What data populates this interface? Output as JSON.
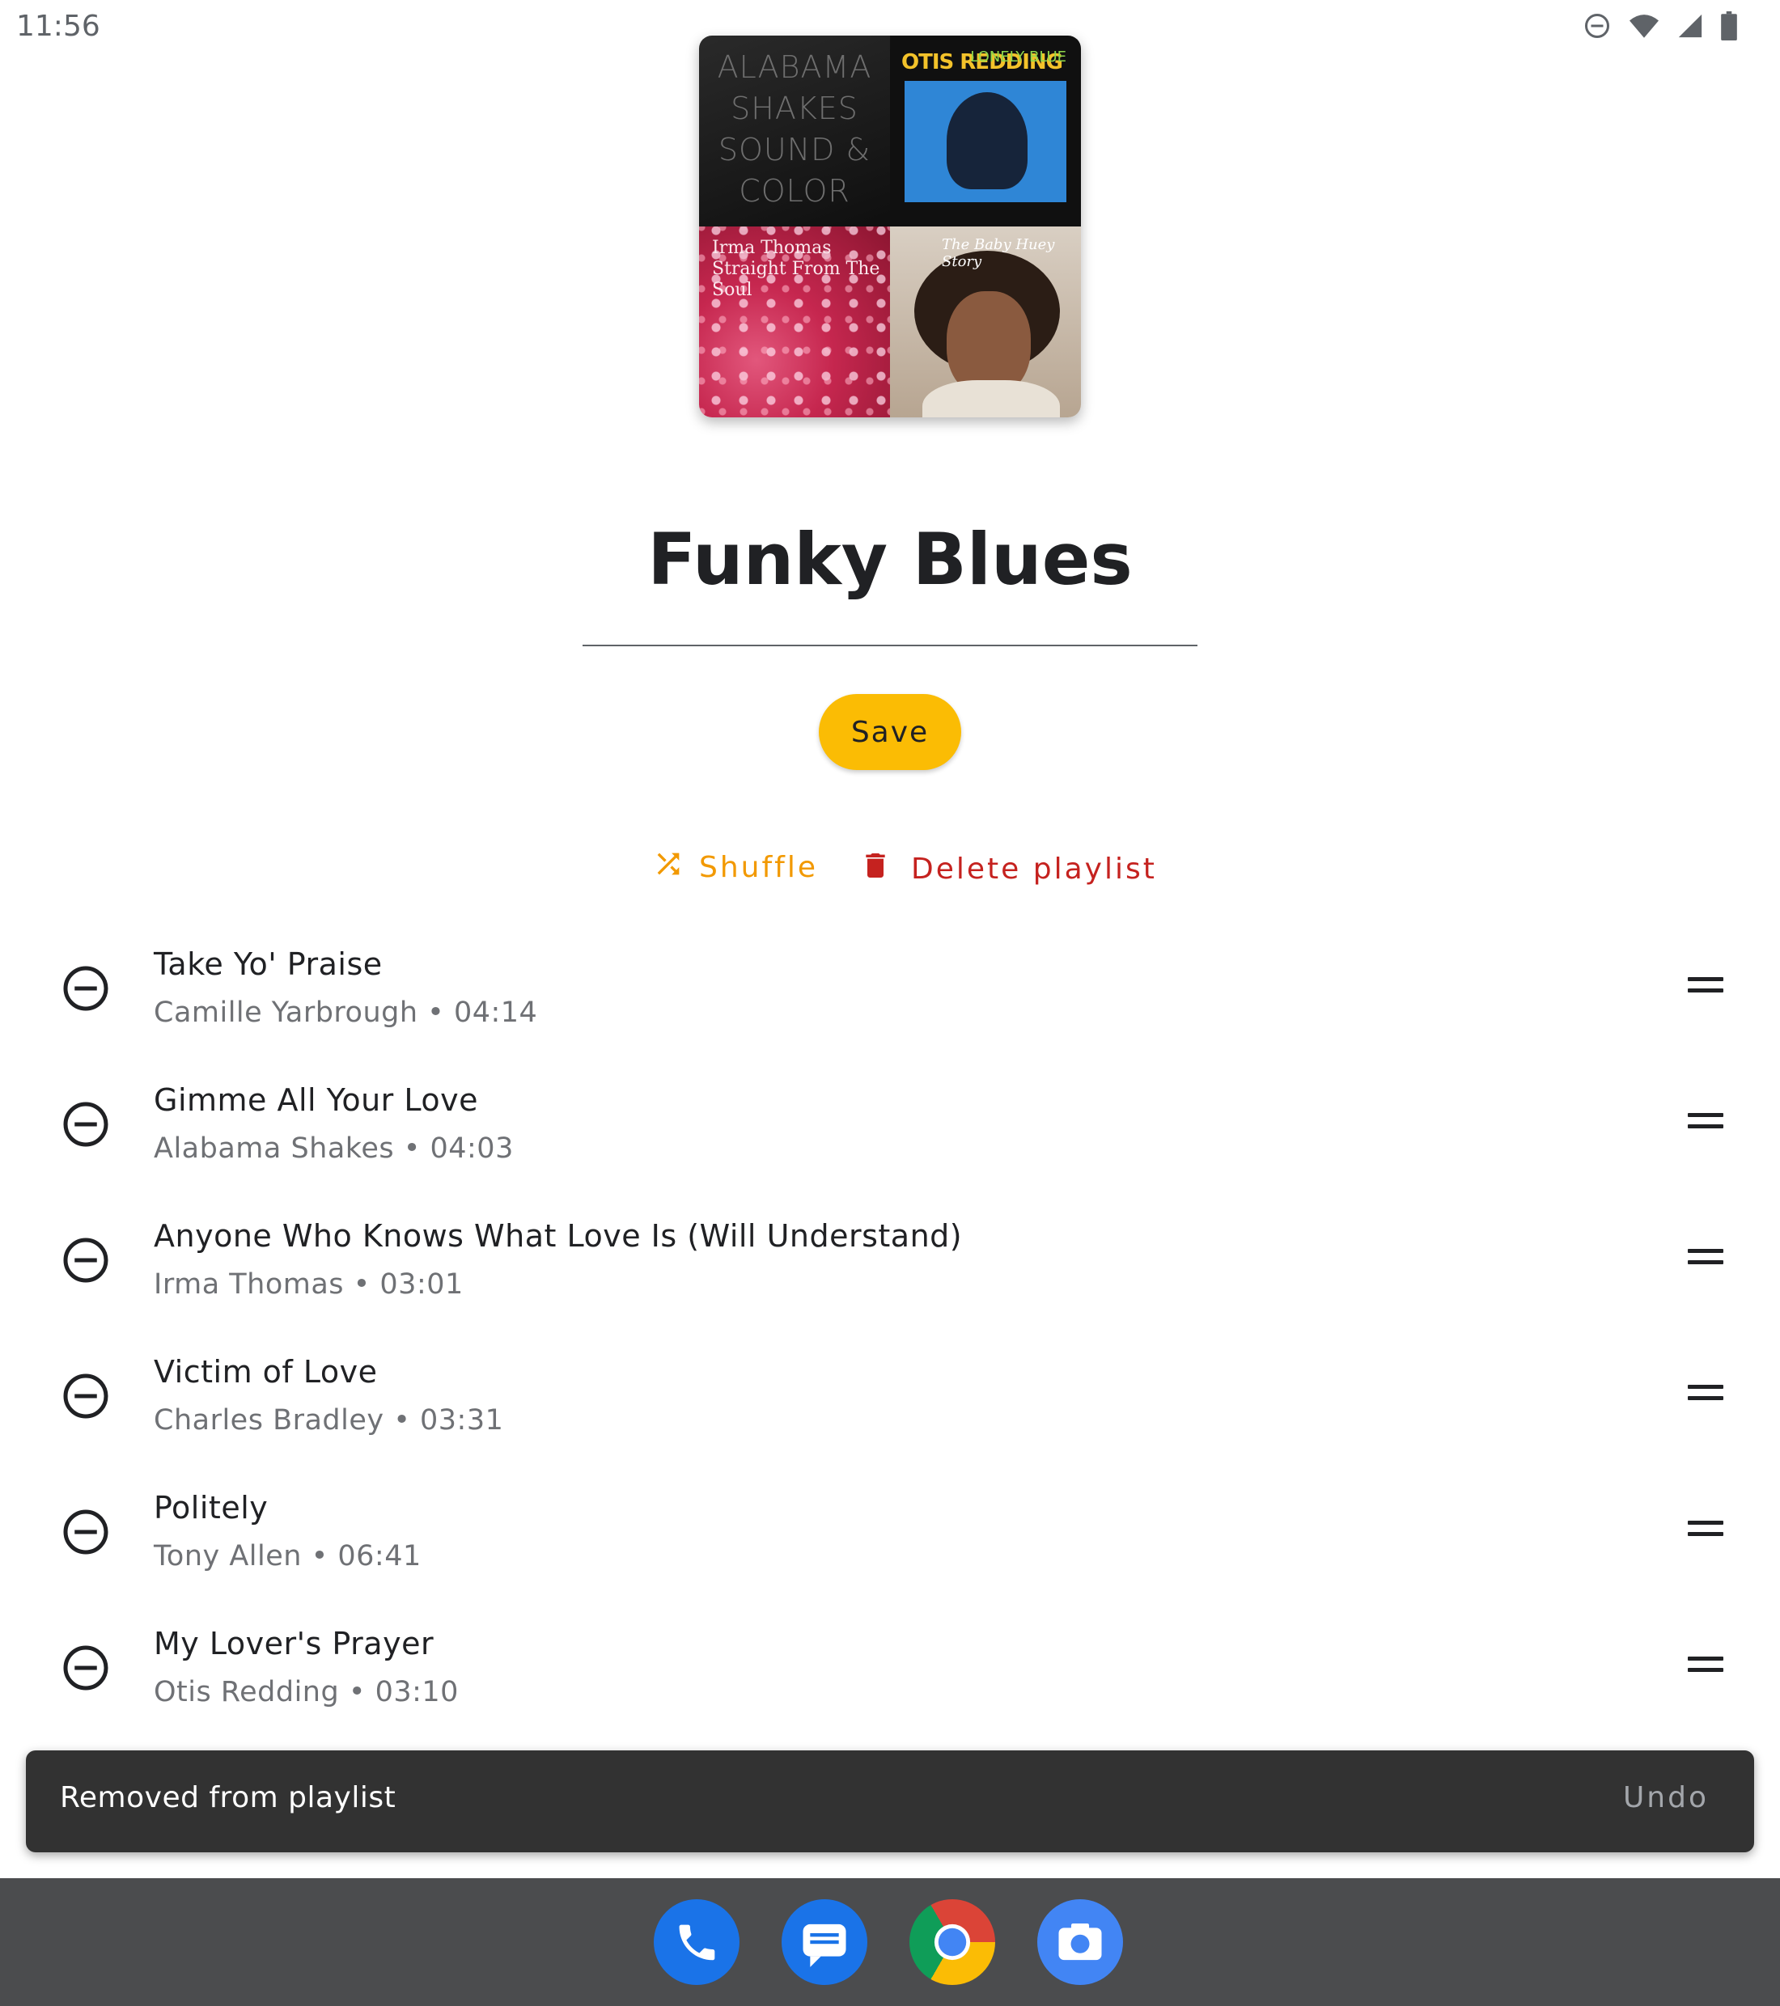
{
  "status_bar": {
    "time": "11:56",
    "icons": [
      "dnd-icon",
      "wifi-icon",
      "signal-icon",
      "battery-icon"
    ]
  },
  "album_art": {
    "tiles": [
      {
        "name": "alabama-shakes-cover",
        "text": "ALABAMA SHAKES SOUND & COLOR"
      },
      {
        "name": "otis-redding-cover",
        "text": "OTIS REDDING",
        "subtext": "LONELY BLUE"
      },
      {
        "name": "irma-thomas-cover",
        "text": "Irma Thomas Straight From The Soul"
      },
      {
        "name": "baby-huey-cover",
        "text": "The Baby Huey Story"
      }
    ]
  },
  "playlist": {
    "title": "Funky Blues",
    "save_label": "Save",
    "shuffle_label": "Shuffle",
    "delete_label": "Delete playlist"
  },
  "tracks": [
    {
      "title": "Take Yo' Praise",
      "subtitle": "Camille Yarbrough • 04:14"
    },
    {
      "title": "Gimme All Your Love",
      "subtitle": "Alabama Shakes • 04:03"
    },
    {
      "title": "Anyone Who Knows What Love Is (Will Understand)",
      "subtitle": "Irma Thomas • 03:01"
    },
    {
      "title": "Victim of Love",
      "subtitle": "Charles Bradley • 03:31"
    },
    {
      "title": "Politely",
      "subtitle": "Tony Allen • 06:41"
    },
    {
      "title": "My Lover's Prayer",
      "subtitle": "Otis Redding • 03:10"
    }
  ],
  "snackbar": {
    "message": "Removed from playlist",
    "action": "Undo"
  },
  "dock": {
    "apps": [
      "phone-app-icon",
      "messages-app-icon",
      "chrome-app-icon",
      "camera-app-icon"
    ]
  },
  "colors": {
    "accent_yellow": "#fbbc04",
    "shuffle_orange": "#f29900",
    "delete_red": "#c5221f",
    "snackbar_bg": "#323232"
  }
}
